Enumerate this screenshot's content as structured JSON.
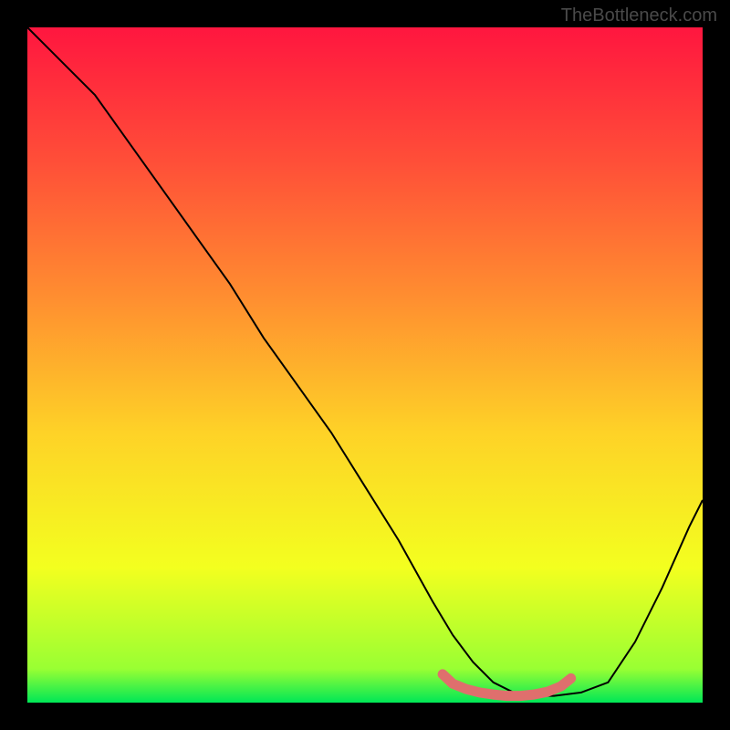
{
  "attribution": "TheBottleneck.com",
  "plot": {
    "inner_x": 30,
    "inner_y": 30,
    "inner_w": 740,
    "inner_h": 740
  },
  "chart_data": {
    "type": "line",
    "title": "",
    "xlabel": "",
    "ylabel": "",
    "xlim": [
      0,
      100
    ],
    "ylim": [
      0,
      100
    ],
    "background_gradient": {
      "stops": [
        {
          "offset": 0.0,
          "color": "#ff163f"
        },
        {
          "offset": 0.2,
          "color": "#ff4f38"
        },
        {
          "offset": 0.4,
          "color": "#ff8e30"
        },
        {
          "offset": 0.6,
          "color": "#fed227"
        },
        {
          "offset": 0.8,
          "color": "#f3ff1f"
        },
        {
          "offset": 0.95,
          "color": "#99ff33"
        },
        {
          "offset": 1.0,
          "color": "#00e756"
        }
      ]
    },
    "series": [
      {
        "name": "bottleneck-curve",
        "color": "#000000",
        "x": [
          0,
          3,
          6,
          10,
          15,
          20,
          25,
          30,
          35,
          40,
          45,
          50,
          55,
          60,
          63,
          66,
          69,
          72,
          75,
          78,
          82,
          86,
          90,
          94,
          98,
          100
        ],
        "y": [
          100,
          97,
          94,
          90,
          83,
          76,
          69,
          62,
          54,
          47,
          40,
          32,
          24,
          15,
          10,
          6,
          3,
          1.5,
          1,
          1,
          1.5,
          3,
          9,
          17,
          26,
          30
        ]
      }
    ],
    "highlight": {
      "name": "optimal-region",
      "color": "#df6f6d",
      "x": [
        61.5,
        63,
        65,
        67,
        69,
        71,
        73,
        75,
        77,
        79,
        80.5
      ],
      "y": [
        4.2,
        2.8,
        2.0,
        1.5,
        1.2,
        1.0,
        1.0,
        1.2,
        1.6,
        2.4,
        3.6
      ]
    }
  }
}
